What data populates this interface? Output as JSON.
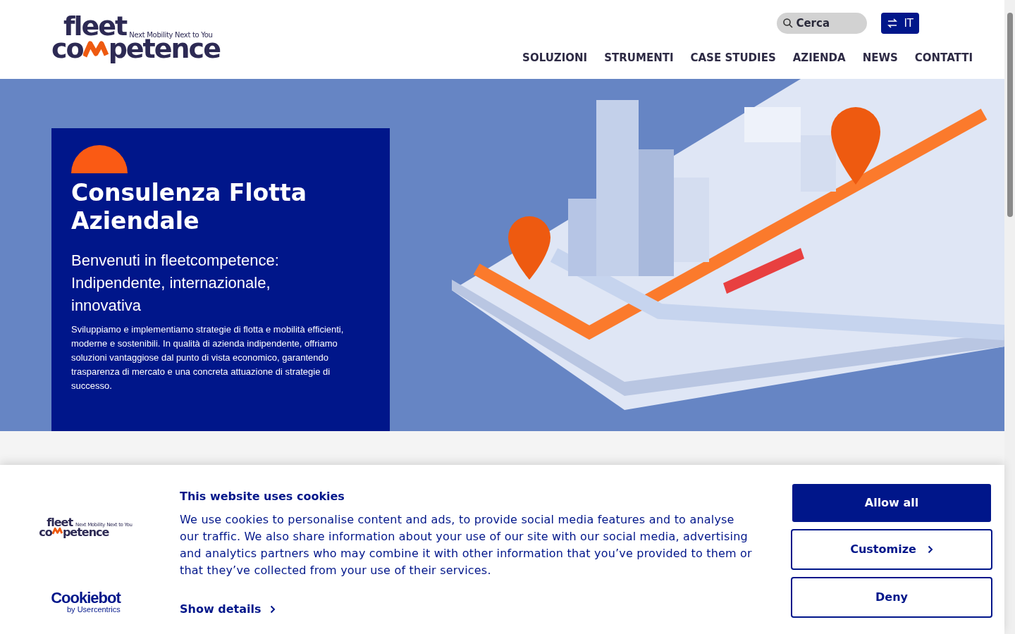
{
  "header": {
    "logo": {
      "top": "fleet",
      "tagline": "Next Mobility Next to You",
      "bottom_left": "co",
      "bottom_right": "petence"
    },
    "search": {
      "placeholder": "Cerca"
    },
    "language_button": {
      "label": "IT"
    },
    "nav": [
      {
        "label": "SOLUZIONI"
      },
      {
        "label": "STRUMENTI"
      },
      {
        "label": "CASE STUDIES"
      },
      {
        "label": "AZIENDA"
      },
      {
        "label": "NEWS"
      },
      {
        "label": "CONTATTI"
      }
    ]
  },
  "hero": {
    "title": "Consulenza Flotta Aziendale",
    "subtitle": "Benvenuti in fleetcompetence: Indipendente, internazionale, innovativa",
    "text": "Sviluppiamo e implementiamo strategie di flotta e mobilità efficienti, moderne e sostenibili. In qualità di azienda indipendente, offriamo soluzioni vantaggiose dal punto di vista economico, garantendo trasparenza di mercato e una concreta attuazione di strategie di successo."
  },
  "cookie_banner": {
    "logo": {
      "top": "fleet",
      "tagline": "Next Mobility Next to You",
      "bottom_left": "co",
      "bottom_right": "petence"
    },
    "provider": {
      "name": "Cookiebot",
      "byline": "by Usercentrics"
    },
    "title": "This website uses cookies",
    "text": "We use cookies to personalise content and ads, to provide social media features and to analyse our traffic. We also share information about your use of our site with our social media, advertising and analytics partners who may combine it with other information that you’ve provided to them or that they’ve collected from your use of their services.",
    "details_link": "Show details",
    "buttons": [
      {
        "label": "Allow all",
        "kind": "primary"
      },
      {
        "label": "Customize",
        "kind": "chevron"
      },
      {
        "label": "Deny",
        "kind": "outline"
      }
    ]
  }
}
